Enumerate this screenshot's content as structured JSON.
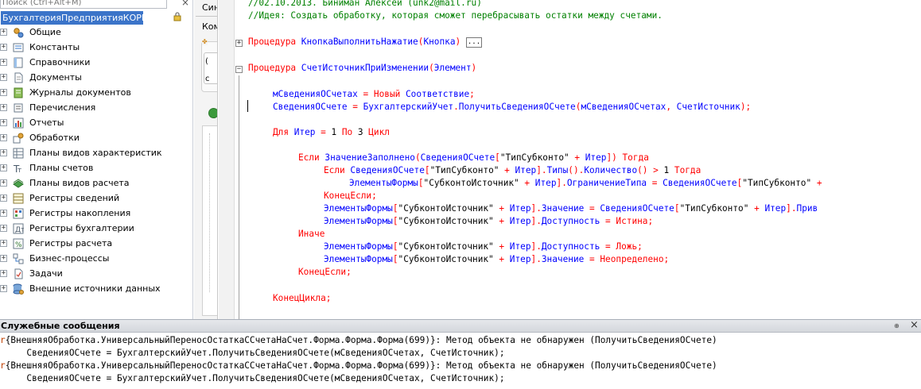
{
  "tree": {
    "search_placeholder": "Поиск (Ctrl+Alt+M)",
    "close_glyph": "×",
    "root_label": "БухгалтерияПредприятияКОРП",
    "items": [
      {
        "label": "Общие",
        "icon": "gears-icon"
      },
      {
        "label": "Константы",
        "icon": "constants-icon"
      },
      {
        "label": "Справочники",
        "icon": "catalogs-icon"
      },
      {
        "label": "Документы",
        "icon": "documents-icon"
      },
      {
        "label": "Журналы документов",
        "icon": "journals-icon"
      },
      {
        "label": "Перечисления",
        "icon": "enums-icon"
      },
      {
        "label": "Отчеты",
        "icon": "reports-icon"
      },
      {
        "label": "Обработки",
        "icon": "dataprocessors-icon"
      },
      {
        "label": "Планы видов характеристик",
        "icon": "chart-of-characteristic-types-icon"
      },
      {
        "label": "Планы счетов",
        "icon": "chart-of-accounts-icon"
      },
      {
        "label": "Планы видов расчета",
        "icon": "chart-of-calculation-types-icon"
      },
      {
        "label": "Регистры сведений",
        "icon": "information-registers-icon"
      },
      {
        "label": "Регистры накопления",
        "icon": "accumulation-registers-icon"
      },
      {
        "label": "Регистры бухгалтерии",
        "icon": "accounting-registers-icon"
      },
      {
        "label": "Регистры расчета",
        "icon": "calculation-registers-icon"
      },
      {
        "label": "Бизнес-процессы",
        "icon": "business-processes-icon"
      },
      {
        "label": "Задачи",
        "icon": "tasks-icon"
      },
      {
        "label": "Внешние источники данных",
        "icon": "external-data-sources-icon"
      }
    ]
  },
  "middle": {
    "tab1": "Син",
    "tab2": "Ком",
    "inner_glyph1": "(",
    "inner_glyph2": "с"
  },
  "code": {
    "fold_expand": "+",
    "fold_collapse": "−",
    "lines": [
      {
        "segs": [
          [
            "c-comment",
            "//02.10.2013. Биниман Алексей (unk2@mail.ru)"
          ]
        ]
      },
      {
        "segs": [
          [
            "c-comment",
            "//Идея: Создать обработку, которая сможет перебрасывать остатки между счетами."
          ]
        ]
      },
      {
        "segs": [
          [
            "c-kw",
            "Процедура "
          ],
          [
            "c-id",
            "КнопкаВыполнитьНажатие"
          ],
          [
            "c-op",
            "("
          ],
          [
            "c-id",
            "Кнопка"
          ],
          [
            "c-op",
            ")"
          ],
          [
            "c-str",
            " "
          ],
          [
            "c-fold",
            "..."
          ]
        ]
      },
      {
        "segs": [
          [
            "c-kw",
            "Процедура "
          ],
          [
            "c-id",
            "СчетИсточникПриИзменении"
          ],
          [
            "c-op",
            "("
          ],
          [
            "c-id",
            "Элемент"
          ],
          [
            "c-op",
            ")"
          ]
        ]
      },
      {
        "segs": [
          [
            "c-id",
            "мСведенияОСчетах"
          ],
          [
            "c-op",
            " = "
          ],
          [
            "c-kw",
            "Новый "
          ],
          [
            "c-id",
            "Соответствие"
          ],
          [
            "c-op",
            ";"
          ]
        ]
      },
      {
        "segs": [
          [
            "c-id",
            "СведенияОСчете"
          ],
          [
            "c-op",
            " = "
          ],
          [
            "c-id",
            "БухгалтерскийУчет"
          ],
          [
            "c-op",
            "."
          ],
          [
            "c-id",
            "ПолучитьСведенияОСчете"
          ],
          [
            "c-op",
            "("
          ],
          [
            "c-id",
            "мСведенияОСчетах"
          ],
          [
            "c-op",
            ", "
          ],
          [
            "c-id",
            "СчетИсточник"
          ],
          [
            "c-op",
            ");"
          ]
        ]
      },
      {
        "segs": [
          [
            "c-kw",
            "Для "
          ],
          [
            "c-id",
            "Итер"
          ],
          [
            "c-op",
            " = "
          ],
          [
            "c-num",
            "1"
          ],
          [
            "c-kw",
            " По "
          ],
          [
            "c-num",
            "3"
          ],
          [
            "c-kw",
            " Цикл"
          ]
        ]
      },
      {
        "segs": [
          [
            "c-kw",
            "Если "
          ],
          [
            "c-id",
            "ЗначениеЗаполнено"
          ],
          [
            "c-op",
            "("
          ],
          [
            "c-id",
            "СведенияОСчете"
          ],
          [
            "c-op",
            "["
          ],
          [
            "c-str",
            "\"ТипСубконто\""
          ],
          [
            "c-op",
            " + "
          ],
          [
            "c-id",
            "Итер"
          ],
          [
            "c-op",
            "])"
          ],
          [
            "c-kw",
            " Тогда"
          ]
        ]
      },
      {
        "segs": [
          [
            "c-kw",
            "Если "
          ],
          [
            "c-id",
            "СведенияОСчете"
          ],
          [
            "c-op",
            "["
          ],
          [
            "c-str",
            "\"ТипСубконто\""
          ],
          [
            "c-op",
            " + "
          ],
          [
            "c-id",
            "Итер"
          ],
          [
            "c-op",
            "]."
          ],
          [
            "c-id",
            "Типы"
          ],
          [
            "c-op",
            "()."
          ],
          [
            "c-id",
            "Количество"
          ],
          [
            "c-op",
            "() > "
          ],
          [
            "c-num",
            "1"
          ],
          [
            "c-kw",
            " Тогда"
          ]
        ]
      },
      {
        "segs": [
          [
            "c-id",
            "ЭлементыФормы"
          ],
          [
            "c-op",
            "["
          ],
          [
            "c-str",
            "\"СубконтоИсточник\""
          ],
          [
            "c-op",
            " + "
          ],
          [
            "c-id",
            "Итер"
          ],
          [
            "c-op",
            "]."
          ],
          [
            "c-id",
            "ОграничениеТипа"
          ],
          [
            "c-op",
            " = "
          ],
          [
            "c-id",
            "СведенияОСчете"
          ],
          [
            "c-op",
            "["
          ],
          [
            "c-str",
            "\"ТипСубконто\""
          ],
          [
            "c-op",
            " + "
          ]
        ]
      },
      {
        "segs": [
          [
            "c-kw",
            "КонецЕсли"
          ],
          [
            "c-op",
            ";"
          ]
        ]
      },
      {
        "segs": [
          [
            "c-id",
            "ЭлементыФормы"
          ],
          [
            "c-op",
            "["
          ],
          [
            "c-str",
            "\"СубконтоИсточник\""
          ],
          [
            "c-op",
            " + "
          ],
          [
            "c-id",
            "Итер"
          ],
          [
            "c-op",
            "]."
          ],
          [
            "c-id",
            "Значение"
          ],
          [
            "c-op",
            " = "
          ],
          [
            "c-id",
            "СведенияОСчете"
          ],
          [
            "c-op",
            "["
          ],
          [
            "c-str",
            "\"ТипСубконто\""
          ],
          [
            "c-op",
            " + "
          ],
          [
            "c-id",
            "Итер"
          ],
          [
            "c-op",
            "]."
          ],
          [
            "c-id",
            "Прив"
          ]
        ]
      },
      {
        "segs": [
          [
            "c-id",
            "ЭлементыФормы"
          ],
          [
            "c-op",
            "["
          ],
          [
            "c-str",
            "\"СубконтоИсточник\""
          ],
          [
            "c-op",
            " + "
          ],
          [
            "c-id",
            "Итер"
          ],
          [
            "c-op",
            "]."
          ],
          [
            "c-id",
            "Доступность"
          ],
          [
            "c-op",
            " = "
          ],
          [
            "c-kw",
            "Истина"
          ],
          [
            "c-op",
            ";"
          ]
        ]
      },
      {
        "segs": [
          [
            "c-kw",
            "Иначе"
          ]
        ]
      },
      {
        "segs": [
          [
            "c-id",
            "ЭлементыФормы"
          ],
          [
            "c-op",
            "["
          ],
          [
            "c-str",
            "\"СубконтоИсточник\""
          ],
          [
            "c-op",
            " + "
          ],
          [
            "c-id",
            "Итер"
          ],
          [
            "c-op",
            "]."
          ],
          [
            "c-id",
            "Доступность"
          ],
          [
            "c-op",
            " = "
          ],
          [
            "c-kw",
            "Ложь"
          ],
          [
            "c-op",
            ";"
          ]
        ]
      },
      {
        "segs": [
          [
            "c-id",
            "ЭлементыФормы"
          ],
          [
            "c-op",
            "["
          ],
          [
            "c-str",
            "\"СубконтоИсточник\""
          ],
          [
            "c-op",
            " + "
          ],
          [
            "c-id",
            "Итер"
          ],
          [
            "c-op",
            "]."
          ],
          [
            "c-id",
            "Значение"
          ],
          [
            "c-op",
            " = "
          ],
          [
            "c-kw",
            "Неопределено"
          ],
          [
            "c-op",
            ";"
          ]
        ]
      },
      {
        "segs": [
          [
            "c-kw",
            "КонецЕсли"
          ],
          [
            "c-op",
            ";"
          ]
        ]
      },
      {
        "segs": [
          [
            "c-kw",
            "КонецЦикла"
          ],
          [
            "c-op",
            ";"
          ]
        ]
      }
    ]
  },
  "messages": {
    "title": "Служебные сообщения",
    "pin_glyph": "⊕",
    "close_glyph": "×",
    "icon_glyph": "r",
    "lines": [
      "{ВнешняяОбработка.УниверсальныйПереносОстаткаССчетаНаСчет.Форма.Форма.Форма(699)}: Метод объекта не обнаружен (ПолучитьСведенияОСчете)",
      "    СведенияОСчете = БухгалтерскийУчет.ПолучитьСведенияОСчете(мСведенияОСчетах, СчетИсточник);",
      "{ВнешняяОбработка.УниверсальныйПереносОстаткаССчетаНаСчет.Форма.Форма.Форма(699)}: Метод объекта не обнаружен (ПолучитьСведенияОСчете)",
      "    СведенияОСчете = БухгалтерскийУчет.ПолучитьСведенияОСчете(мСведенияОСчетах, СчетИсточник);"
    ]
  }
}
